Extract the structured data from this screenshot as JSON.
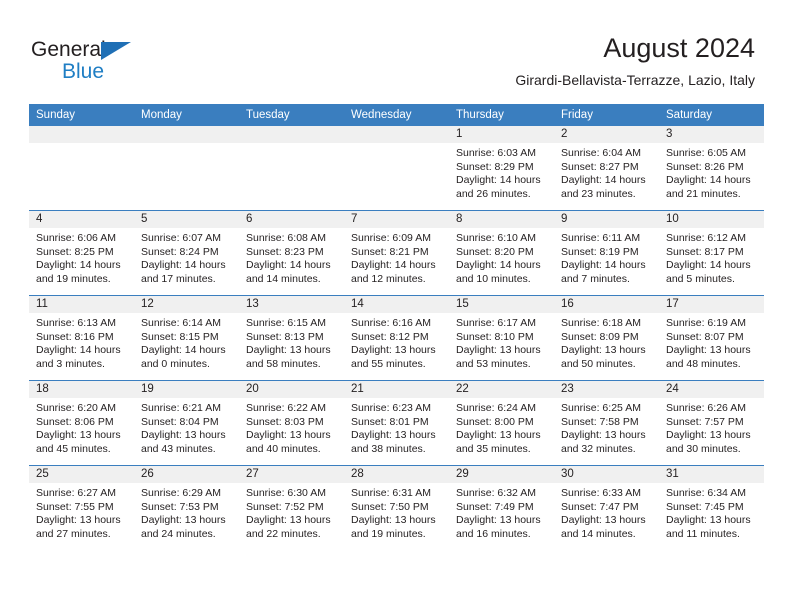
{
  "brand": {
    "logo_text_top": "General",
    "logo_text_bottom": "Blue",
    "logo_icon": "triangle-icon",
    "accent_color": "#1f7ec4",
    "header_color": "#3a7ebf"
  },
  "header": {
    "title": "August 2024",
    "subtitle": "Girardi-Bellavista-Terrazze, Lazio, Italy"
  },
  "calendar": {
    "weekday_headers": [
      "Sunday",
      "Monday",
      "Tuesday",
      "Wednesday",
      "Thursday",
      "Friday",
      "Saturday"
    ],
    "weeks": [
      [
        {
          "date": "",
          "blank": true
        },
        {
          "date": "",
          "blank": true
        },
        {
          "date": "",
          "blank": true
        },
        {
          "date": "",
          "blank": true
        },
        {
          "date": "1",
          "sunrise": "Sunrise: 6:03 AM",
          "sunset": "Sunset: 8:29 PM",
          "daylight": "Daylight: 14 hours and 26 minutes."
        },
        {
          "date": "2",
          "sunrise": "Sunrise: 6:04 AM",
          "sunset": "Sunset: 8:27 PM",
          "daylight": "Daylight: 14 hours and 23 minutes."
        },
        {
          "date": "3",
          "sunrise": "Sunrise: 6:05 AM",
          "sunset": "Sunset: 8:26 PM",
          "daylight": "Daylight: 14 hours and 21 minutes."
        }
      ],
      [
        {
          "date": "4",
          "sunrise": "Sunrise: 6:06 AM",
          "sunset": "Sunset: 8:25 PM",
          "daylight": "Daylight: 14 hours and 19 minutes."
        },
        {
          "date": "5",
          "sunrise": "Sunrise: 6:07 AM",
          "sunset": "Sunset: 8:24 PM",
          "daylight": "Daylight: 14 hours and 17 minutes."
        },
        {
          "date": "6",
          "sunrise": "Sunrise: 6:08 AM",
          "sunset": "Sunset: 8:23 PM",
          "daylight": "Daylight: 14 hours and 14 minutes."
        },
        {
          "date": "7",
          "sunrise": "Sunrise: 6:09 AM",
          "sunset": "Sunset: 8:21 PM",
          "daylight": "Daylight: 14 hours and 12 minutes."
        },
        {
          "date": "8",
          "sunrise": "Sunrise: 6:10 AM",
          "sunset": "Sunset: 8:20 PM",
          "daylight": "Daylight: 14 hours and 10 minutes."
        },
        {
          "date": "9",
          "sunrise": "Sunrise: 6:11 AM",
          "sunset": "Sunset: 8:19 PM",
          "daylight": "Daylight: 14 hours and 7 minutes."
        },
        {
          "date": "10",
          "sunrise": "Sunrise: 6:12 AM",
          "sunset": "Sunset: 8:17 PM",
          "daylight": "Daylight: 14 hours and 5 minutes."
        }
      ],
      [
        {
          "date": "11",
          "sunrise": "Sunrise: 6:13 AM",
          "sunset": "Sunset: 8:16 PM",
          "daylight": "Daylight: 14 hours and 3 minutes."
        },
        {
          "date": "12",
          "sunrise": "Sunrise: 6:14 AM",
          "sunset": "Sunset: 8:15 PM",
          "daylight": "Daylight: 14 hours and 0 minutes."
        },
        {
          "date": "13",
          "sunrise": "Sunrise: 6:15 AM",
          "sunset": "Sunset: 8:13 PM",
          "daylight": "Daylight: 13 hours and 58 minutes."
        },
        {
          "date": "14",
          "sunrise": "Sunrise: 6:16 AM",
          "sunset": "Sunset: 8:12 PM",
          "daylight": "Daylight: 13 hours and 55 minutes."
        },
        {
          "date": "15",
          "sunrise": "Sunrise: 6:17 AM",
          "sunset": "Sunset: 8:10 PM",
          "daylight": "Daylight: 13 hours and 53 minutes."
        },
        {
          "date": "16",
          "sunrise": "Sunrise: 6:18 AM",
          "sunset": "Sunset: 8:09 PM",
          "daylight": "Daylight: 13 hours and 50 minutes."
        },
        {
          "date": "17",
          "sunrise": "Sunrise: 6:19 AM",
          "sunset": "Sunset: 8:07 PM",
          "daylight": "Daylight: 13 hours and 48 minutes."
        }
      ],
      [
        {
          "date": "18",
          "sunrise": "Sunrise: 6:20 AM",
          "sunset": "Sunset: 8:06 PM",
          "daylight": "Daylight: 13 hours and 45 minutes."
        },
        {
          "date": "19",
          "sunrise": "Sunrise: 6:21 AM",
          "sunset": "Sunset: 8:04 PM",
          "daylight": "Daylight: 13 hours and 43 minutes."
        },
        {
          "date": "20",
          "sunrise": "Sunrise: 6:22 AM",
          "sunset": "Sunset: 8:03 PM",
          "daylight": "Daylight: 13 hours and 40 minutes."
        },
        {
          "date": "21",
          "sunrise": "Sunrise: 6:23 AM",
          "sunset": "Sunset: 8:01 PM",
          "daylight": "Daylight: 13 hours and 38 minutes."
        },
        {
          "date": "22",
          "sunrise": "Sunrise: 6:24 AM",
          "sunset": "Sunset: 8:00 PM",
          "daylight": "Daylight: 13 hours and 35 minutes."
        },
        {
          "date": "23",
          "sunrise": "Sunrise: 6:25 AM",
          "sunset": "Sunset: 7:58 PM",
          "daylight": "Daylight: 13 hours and 32 minutes."
        },
        {
          "date": "24",
          "sunrise": "Sunrise: 6:26 AM",
          "sunset": "Sunset: 7:57 PM",
          "daylight": "Daylight: 13 hours and 30 minutes."
        }
      ],
      [
        {
          "date": "25",
          "sunrise": "Sunrise: 6:27 AM",
          "sunset": "Sunset: 7:55 PM",
          "daylight": "Daylight: 13 hours and 27 minutes."
        },
        {
          "date": "26",
          "sunrise": "Sunrise: 6:29 AM",
          "sunset": "Sunset: 7:53 PM",
          "daylight": "Daylight: 13 hours and 24 minutes."
        },
        {
          "date": "27",
          "sunrise": "Sunrise: 6:30 AM",
          "sunset": "Sunset: 7:52 PM",
          "daylight": "Daylight: 13 hours and 22 minutes."
        },
        {
          "date": "28",
          "sunrise": "Sunrise: 6:31 AM",
          "sunset": "Sunset: 7:50 PM",
          "daylight": "Daylight: 13 hours and 19 minutes."
        },
        {
          "date": "29",
          "sunrise": "Sunrise: 6:32 AM",
          "sunset": "Sunset: 7:49 PM",
          "daylight": "Daylight: 13 hours and 16 minutes."
        },
        {
          "date": "30",
          "sunrise": "Sunrise: 6:33 AM",
          "sunset": "Sunset: 7:47 PM",
          "daylight": "Daylight: 13 hours and 14 minutes."
        },
        {
          "date": "31",
          "sunrise": "Sunrise: 6:34 AM",
          "sunset": "Sunset: 7:45 PM",
          "daylight": "Daylight: 13 hours and 11 minutes."
        }
      ]
    ]
  }
}
